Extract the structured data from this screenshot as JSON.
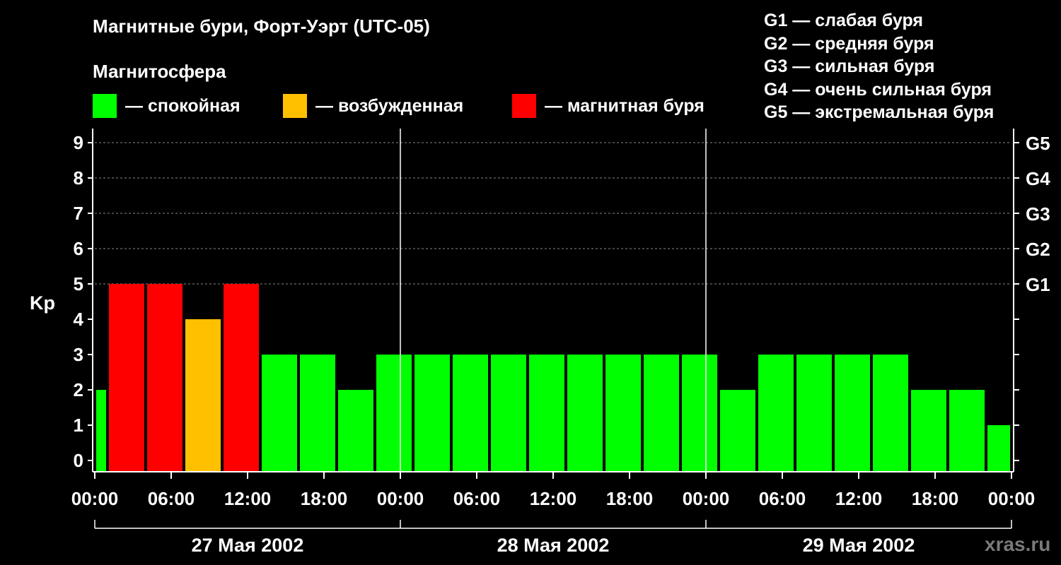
{
  "chart_data": {
    "type": "bar",
    "title": "Магнитные бури, Форт-Уэрт (UTC-05)",
    "legend_title": "Магнитосфера",
    "legend": [
      {
        "label": "— спокойная",
        "color": "#00ff00"
      },
      {
        "label": "— возбужденная",
        "color": "#ffc000"
      },
      {
        "label": "— магнитная буря",
        "color": "#ff0000"
      }
    ],
    "storm_scale": [
      "G1 — слабая буря",
      "G2 — средняя буря",
      "G3 — сильная буря",
      "G4 — очень сильная буря",
      "G5 — экстремальная буря"
    ],
    "ylabel": "Kp",
    "ylim": [
      0,
      9
    ],
    "yticks": [
      "0",
      "1",
      "2",
      "3",
      "4",
      "5",
      "6",
      "7",
      "8",
      "9"
    ],
    "right_ticks": [
      {
        "value": 5,
        "label": "G1"
      },
      {
        "value": 6,
        "label": "G2"
      },
      {
        "value": 7,
        "label": "G3"
      },
      {
        "value": 8,
        "label": "G4"
      },
      {
        "value": 9,
        "label": "G5"
      }
    ],
    "xlim_hours": [
      0,
      72
    ],
    "x_tick_hours": [
      0,
      6,
      12,
      18,
      24,
      30,
      36,
      42,
      48,
      54,
      60,
      66,
      72
    ],
    "x_tick_labels": [
      "00:00",
      "06:00",
      "12:00",
      "18:00",
      "00:00",
      "06:00",
      "12:00",
      "18:00",
      "00:00",
      "06:00",
      "12:00",
      "18:00",
      "00:00"
    ],
    "day_separators_hours": [
      24,
      48
    ],
    "dates": [
      "27 Мая 2002",
      "28 Мая 2002",
      "29 Мая 2002"
    ],
    "grid": "dashed, y = 5 to 9",
    "bars": [
      {
        "start": 0,
        "end": 1,
        "kp": 2,
        "state": "quiet"
      },
      {
        "start": 1,
        "end": 4,
        "kp": 5,
        "state": "storm"
      },
      {
        "start": 4,
        "end": 7,
        "kp": 5,
        "state": "storm"
      },
      {
        "start": 7,
        "end": 10,
        "kp": 4,
        "state": "active"
      },
      {
        "start": 10,
        "end": 13,
        "kp": 5,
        "state": "storm"
      },
      {
        "start": 13,
        "end": 16,
        "kp": 3,
        "state": "quiet"
      },
      {
        "start": 16,
        "end": 19,
        "kp": 3,
        "state": "quiet"
      },
      {
        "start": 19,
        "end": 22,
        "kp": 2,
        "state": "quiet"
      },
      {
        "start": 22,
        "end": 25,
        "kp": 3,
        "state": "quiet"
      },
      {
        "start": 25,
        "end": 28,
        "kp": 3,
        "state": "quiet"
      },
      {
        "start": 28,
        "end": 31,
        "kp": 3,
        "state": "quiet"
      },
      {
        "start": 31,
        "end": 34,
        "kp": 3,
        "state": "quiet"
      },
      {
        "start": 34,
        "end": 37,
        "kp": 3,
        "state": "quiet"
      },
      {
        "start": 37,
        "end": 40,
        "kp": 3,
        "state": "quiet"
      },
      {
        "start": 40,
        "end": 43,
        "kp": 3,
        "state": "quiet"
      },
      {
        "start": 43,
        "end": 46,
        "kp": 3,
        "state": "quiet"
      },
      {
        "start": 46,
        "end": 49,
        "kp": 3,
        "state": "quiet"
      },
      {
        "start": 49,
        "end": 52,
        "kp": 2,
        "state": "quiet"
      },
      {
        "start": 52,
        "end": 55,
        "kp": 3,
        "state": "quiet"
      },
      {
        "start": 55,
        "end": 58,
        "kp": 3,
        "state": "quiet"
      },
      {
        "start": 58,
        "end": 61,
        "kp": 3,
        "state": "quiet"
      },
      {
        "start": 61,
        "end": 64,
        "kp": 3,
        "state": "quiet"
      },
      {
        "start": 64,
        "end": 67,
        "kp": 2,
        "state": "quiet"
      },
      {
        "start": 67,
        "end": 70,
        "kp": 2,
        "state": "quiet"
      },
      {
        "start": 70,
        "end": 72,
        "kp": 1,
        "state": "quiet"
      }
    ],
    "state_colors": {
      "quiet": "#00ff00",
      "active": "#ffc000",
      "storm": "#ff0000"
    }
  },
  "watermark": "xras.ru"
}
